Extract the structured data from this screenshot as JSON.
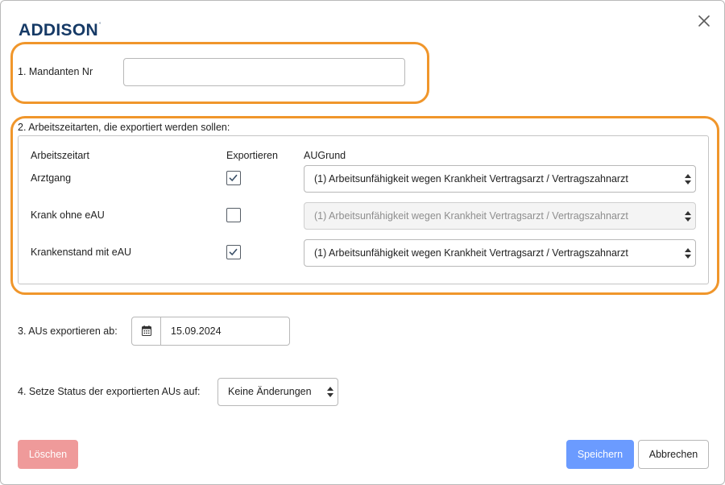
{
  "header": {
    "logo_text": "ADDISON",
    "logo_mark": "°",
    "close_icon": "close-icon"
  },
  "section1": {
    "label": "1. Mandanten Nr",
    "value": ""
  },
  "section2": {
    "label": "2. Arbeitszeitarten, die exportiert werden sollen:",
    "columns": [
      "Arbeitszeitart",
      "Exportieren",
      "AUGrund"
    ],
    "rows": [
      {
        "name": "Arztgang",
        "checked": true,
        "reason": "(1) Arbeitsunfähigkeit wegen Krankheit Vertragsarzt / Vertragszahnarzt",
        "disabled": false
      },
      {
        "name": "Krank ohne eAU",
        "checked": false,
        "reason": "(1) Arbeitsunfähigkeit wegen Krankheit Vertragsarzt / Vertragszahnarzt",
        "disabled": true
      },
      {
        "name": "Krankenstand mit eAU",
        "checked": true,
        "reason": "(1) Arbeitsunfähigkeit wegen Krankheit Vertragsarzt / Vertragszahnarzt",
        "disabled": false
      }
    ]
  },
  "section3": {
    "label": "3. AUs exportieren ab:",
    "date": "15.09.2024",
    "icon": "calendar-icon"
  },
  "section4": {
    "label": "4. Setze Status der exportierten AUs auf:",
    "selected": "Keine Änderungen"
  },
  "footer": {
    "delete_label": "Löschen",
    "save_label": "Speichern",
    "cancel_label": "Abbrechen"
  },
  "colors": {
    "highlight": "#f0962b",
    "brand": "#163a66",
    "save": "#6b9bff",
    "delete": "#ef9a9a"
  }
}
